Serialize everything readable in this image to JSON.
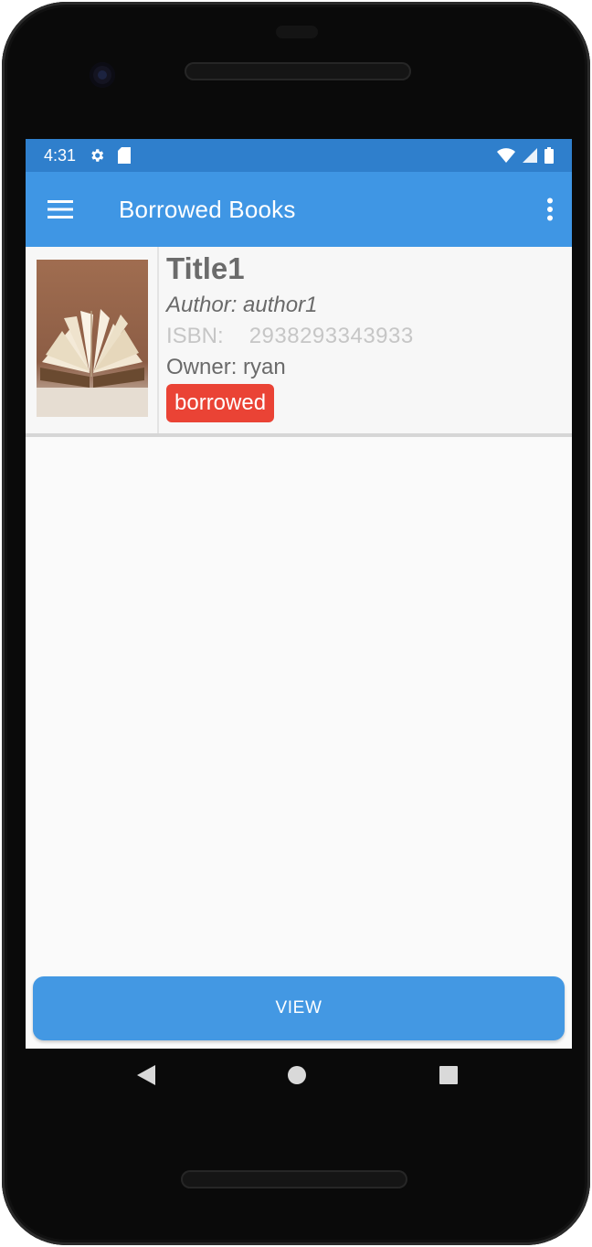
{
  "status_bar": {
    "time": "4:31",
    "icons": [
      "gear-icon",
      "sd-card-icon",
      "wifi-icon",
      "signal-icon",
      "battery-icon"
    ]
  },
  "app_bar": {
    "title": "Borrowed Books",
    "menu_icon": "hamburger-menu-icon",
    "overflow_icon": "more-vert-icon"
  },
  "books": [
    {
      "title": "Title1",
      "author": "Author: author1",
      "isbn_label": "ISBN:",
      "isbn_value": "2938293343933",
      "owner": "Owner: ryan",
      "status": "borrowed"
    }
  ],
  "actions": {
    "view_label": "VIEW"
  },
  "nav_bar": {
    "icons": [
      "back-triangle-icon",
      "home-circle-icon",
      "recents-square-icon"
    ]
  },
  "colors": {
    "status_bar": "#2f7fcc",
    "app_bar": "#3f96e4",
    "badge": "#ea4335",
    "button": "#4398e3"
  }
}
